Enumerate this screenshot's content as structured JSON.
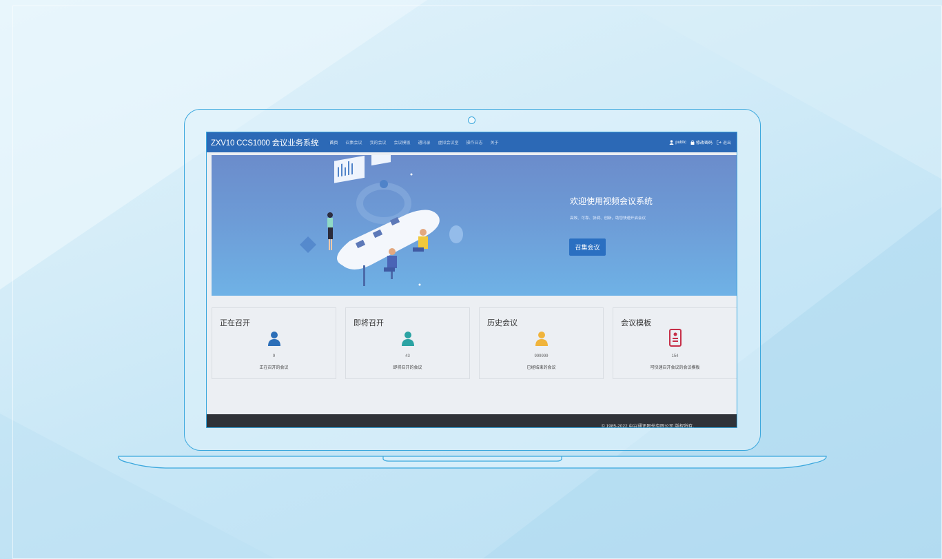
{
  "nav": {
    "brand": "ZXV10 CCS1000 会议业务系统",
    "items": [
      {
        "label": "首页",
        "active": true
      },
      {
        "label": "召集会议"
      },
      {
        "label": "我的会议"
      },
      {
        "label": "会议模板"
      },
      {
        "label": "通讯录"
      },
      {
        "label": "虚拟会议室"
      },
      {
        "label": "操作日志"
      },
      {
        "label": "关于"
      }
    ],
    "user": "public",
    "change_password": "修改密码",
    "logout": "退出"
  },
  "hero": {
    "title": "欢迎使用视频会议系统",
    "subtitle": "高效、可靠、协调、创新，助您快速开启会议",
    "button": "召集会议"
  },
  "cards": [
    {
      "title": "正在召开",
      "count": "9",
      "desc": "正在召开的会议",
      "icon": "user-icon",
      "color": "#2c6fb8"
    },
    {
      "title": "即将召开",
      "count": "43",
      "desc": "即将召开的会议",
      "icon": "user-icon",
      "color": "#2ba3a3"
    },
    {
      "title": "历史会议",
      "count": "999999",
      "desc": "已经结束的会议",
      "icon": "user-icon",
      "color": "#f0b43c"
    },
    {
      "title": "会议模板",
      "count": "154",
      "desc": "可快速召开会议的会议模板",
      "icon": "document-icon",
      "color": "#c62f48"
    }
  ],
  "footer": {
    "copyright": "© 1985-2022 中兴通讯股份有限公司 版权所有."
  }
}
